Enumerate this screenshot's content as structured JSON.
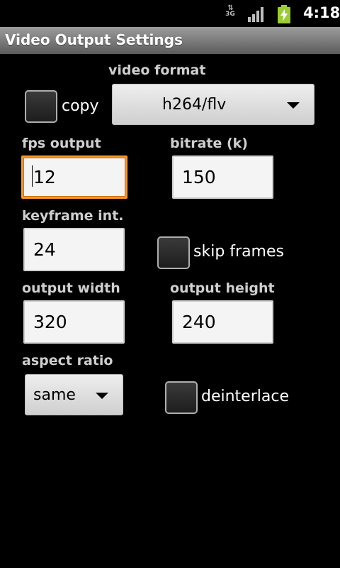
{
  "status_bar": {
    "network": "3G",
    "time": "4:18"
  },
  "title": "Video Output Settings",
  "video_format": {
    "label": "video format",
    "selected": "h264/flv"
  },
  "copy": {
    "label": "copy",
    "checked": false
  },
  "fps_output": {
    "label": "fps output",
    "value": "12"
  },
  "bitrate": {
    "label": "bitrate (k)",
    "value": "150"
  },
  "keyframe": {
    "label": "keyframe int.",
    "value": "24"
  },
  "skip_frames": {
    "label": "skip frames",
    "checked": false
  },
  "output_width": {
    "label": "output width",
    "value": "320"
  },
  "output_height": {
    "label": "output height",
    "value": "240"
  },
  "aspect_ratio": {
    "label": "aspect ratio",
    "selected": "same"
  },
  "deinterlace": {
    "label": "deinterlace",
    "checked": false
  },
  "colors": {
    "focus": "#f8962a",
    "battery": "#9acd32"
  }
}
